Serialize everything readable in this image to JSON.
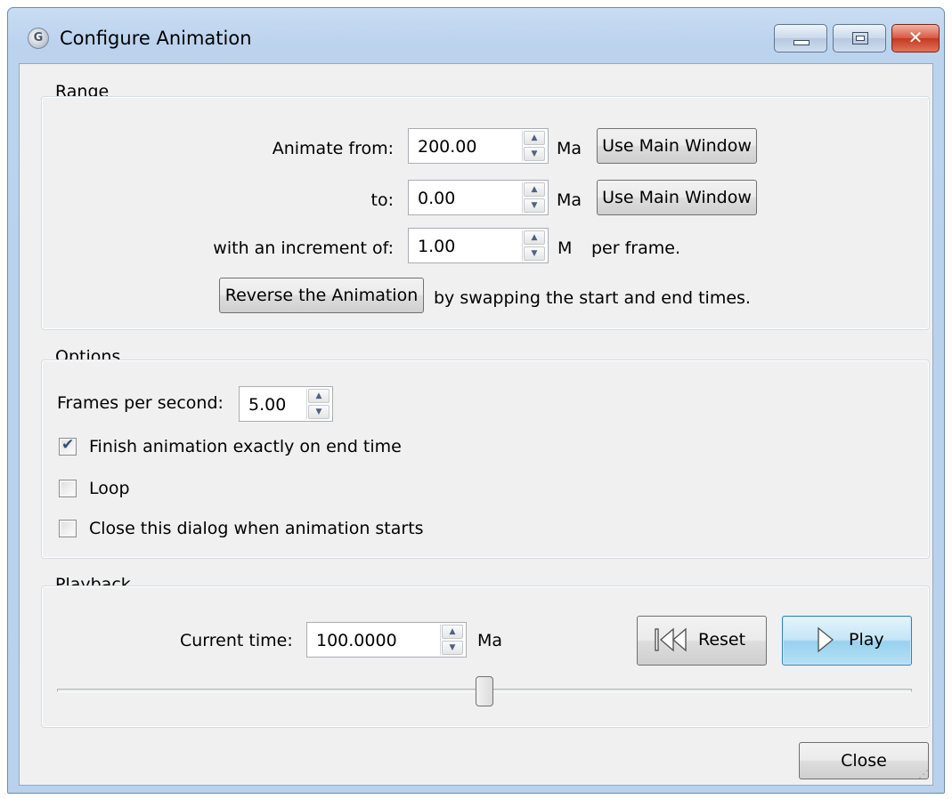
{
  "window": {
    "title": "Configure Animation",
    "icon": "app-globe-icon"
  },
  "range": {
    "group_title": "Range",
    "animate_from_label": "Animate from:",
    "animate_from_value": "200.00",
    "animate_from_unit": "Ma",
    "to_label": "to:",
    "to_value": "0.00",
    "to_unit": "Ma",
    "use_main_window_label": "Use Main Window",
    "increment_label": "with an increment of:",
    "increment_value": "1.00",
    "increment_unit": "M",
    "per_frame_label": "per frame.",
    "reverse_button_label": "Reverse the Animation",
    "reverse_hint": "by swapping the start and end times."
  },
  "options": {
    "group_title": "Options",
    "fps_label": "Frames per second:",
    "fps_value": "5.00",
    "finish_label": "Finish animation exactly on end time",
    "finish_checked": true,
    "loop_label": "Loop",
    "loop_checked": false,
    "close_on_start_label": "Close this dialog when animation starts",
    "close_on_start_checked": false
  },
  "playback": {
    "group_title": "Playback",
    "current_time_label": "Current time:",
    "current_time_value": "100.0000",
    "current_time_unit": "Ma",
    "reset_label": "Reset",
    "play_label": "Play",
    "slider_fraction": 0.5
  },
  "footer": {
    "close_label": "Close"
  },
  "colors": {
    "title_bar": "#bcd3ee",
    "client_bg": "#f0f0f0",
    "close_button": "#c4391f",
    "focus_button": "#98d1ef"
  }
}
